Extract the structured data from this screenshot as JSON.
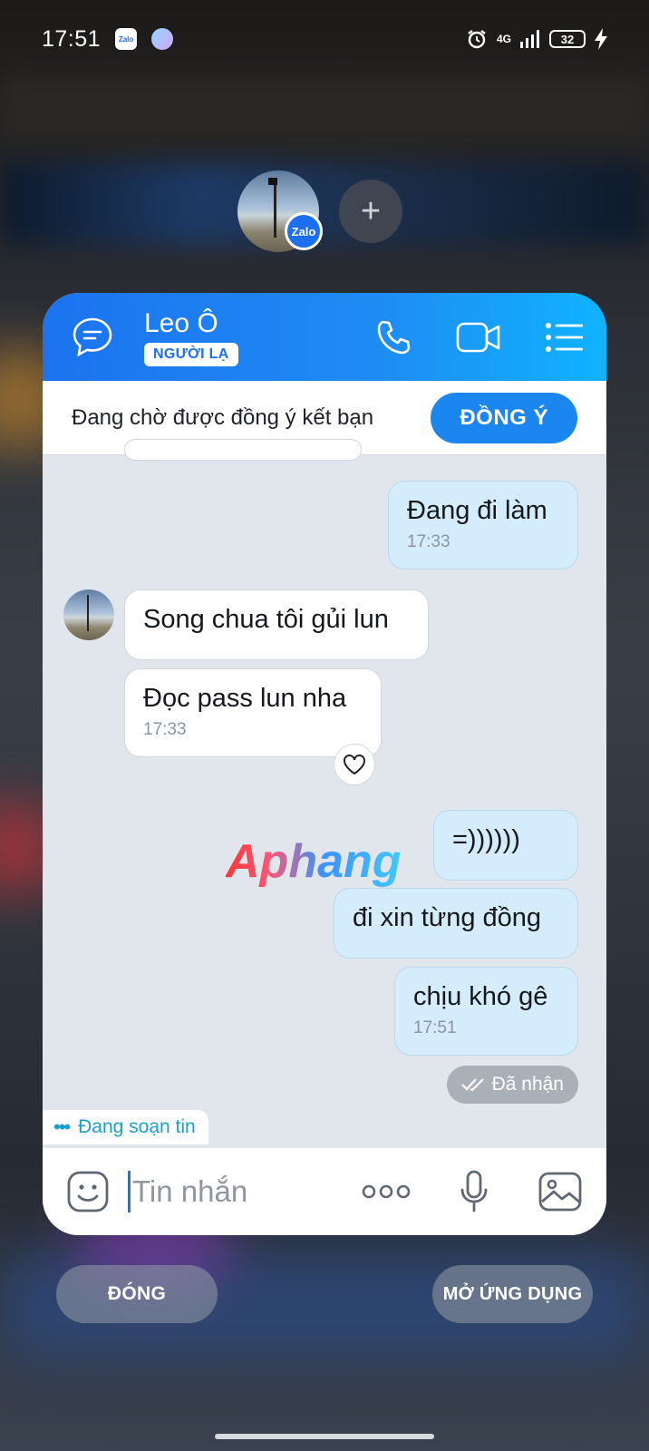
{
  "status_bar": {
    "time": "17:51",
    "zalo_icon": "Zalo",
    "network": "4G",
    "battery": "32"
  },
  "bubble_head": {
    "badge": "Zalo",
    "add": "+"
  },
  "header": {
    "name": "Leo Ô",
    "tag": "NGƯỜI LẠ"
  },
  "friend_request": {
    "text": "Đang chờ được đồng ý kết bạn",
    "button": "ĐỒNG Ý"
  },
  "messages": [
    {
      "from": "me",
      "text": "Đang đi làm",
      "time": "17:33"
    },
    {
      "from": "other",
      "text": "Song chua tôi gủi lun",
      "time": ""
    },
    {
      "from": "other",
      "text": "Đọc pass lun nha",
      "time": "17:33"
    },
    {
      "from": "me",
      "text": "=))))))",
      "time": ""
    },
    {
      "from": "me",
      "text": "đi xin từng đồng",
      "time": ""
    },
    {
      "from": "me",
      "text": "chịu khó gê",
      "time": "17:51"
    }
  ],
  "received_status": "Đã nhận",
  "typing_indicator": "Đang soạn tin",
  "composer": {
    "placeholder": "Tin nhắn",
    "more": "ooo"
  },
  "bottom": {
    "close": "ĐÓNG",
    "open_app": "MỞ ỨNG DỤNG"
  },
  "watermark": "Aphang",
  "colors": {
    "header_blue": "#1c73ef",
    "bubble_me": "#d4ecfb",
    "agree_button": "#1b86f0"
  }
}
